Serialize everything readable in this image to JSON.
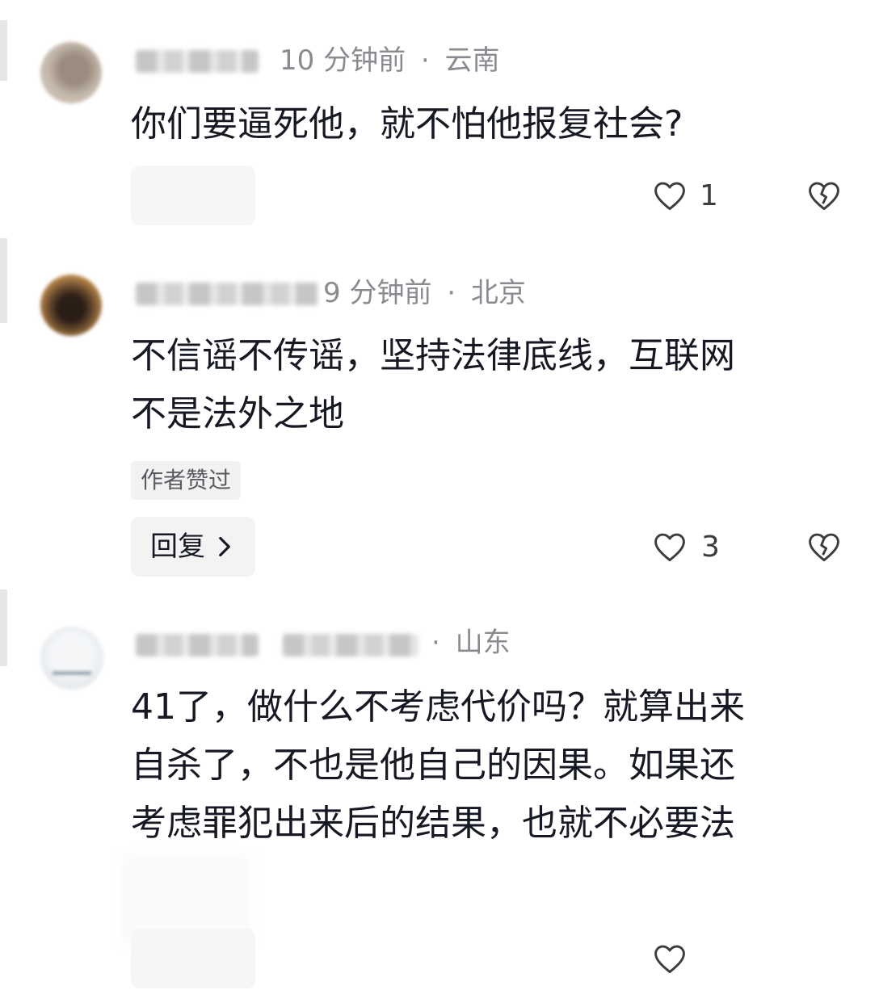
{
  "comments": [
    {
      "time": "10 分钟前",
      "location": "云南",
      "text": "你们要逼死他，就不怕他报复社会?",
      "like_count": "1"
    },
    {
      "time": "9 分钟前",
      "location": "北京",
      "text": "不信谣不传谣，坚持法律底线，互联网\n不是法外之地",
      "author_badge": "作者赞过",
      "reply_label": "回复",
      "like_count": "3"
    },
    {
      "location": "山东",
      "text": "41了，做什么不考虑代价吗？就算出来\n自杀了，不也是他自己的因果。如果还\n考虑罪犯出来后的结果，也就不必要法"
    }
  ],
  "separator": "·",
  "colors": {
    "text": "#161823",
    "meta": "#8a8b91",
    "icon": "#3b3c40"
  },
  "icons": {
    "like": "heart-outline-icon",
    "dislike": "broken-heart-icon",
    "reply_arrow": "chevron-right-icon"
  }
}
